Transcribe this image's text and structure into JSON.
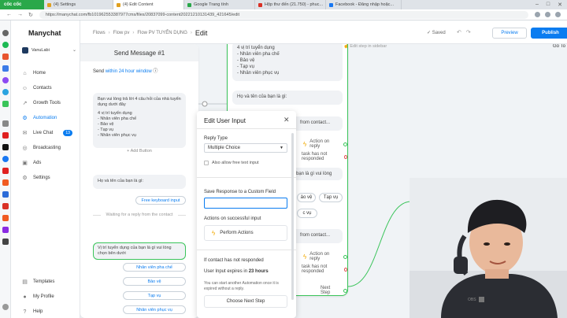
{
  "browser": {
    "brand": "cốc cốc",
    "tabs": [
      {
        "label": "(4) Settings",
        "active": false
      },
      {
        "label": "(4) Edit Content",
        "active": true
      },
      {
        "label": "Google Trang tính",
        "active": false
      },
      {
        "label": "Hộp thư đến (21.750) - phuc...",
        "active": false
      },
      {
        "label": "Facebook - Đăng nhập hoặc...",
        "active": false
      }
    ],
    "url": "https://manychat.com/fb101962553387977cms/files/20837099-content20221210131439_421645/edit"
  },
  "sidebar": {
    "logo": "Manychat",
    "account": "VanuLabi",
    "items": [
      {
        "label": "Home",
        "icon": "home-icon"
      },
      {
        "label": "Contacts",
        "icon": "contacts-icon"
      },
      {
        "label": "Growth Tools",
        "icon": "growth-icon"
      },
      {
        "label": "Automation",
        "icon": "automation-icon",
        "active": true
      },
      {
        "label": "Live Chat",
        "icon": "chat-icon",
        "badge": "13"
      },
      {
        "label": "Broadcasting",
        "icon": "broadcast-icon"
      },
      {
        "label": "Ads",
        "icon": "ads-icon"
      },
      {
        "label": "Settings",
        "icon": "settings-icon"
      }
    ],
    "bottom": [
      {
        "label": "Templates",
        "icon": "templates-icon"
      },
      {
        "label": "My Profile",
        "icon": "profile-icon"
      },
      {
        "label": "Help",
        "icon": "help-icon"
      }
    ]
  },
  "header": {
    "crumbs": [
      "Flows",
      "Flow pv",
      "Flow PV TUYỂN DỤNG"
    ],
    "current": "Edit",
    "saved": "Saved",
    "preview": "Preview",
    "publish": "Publish",
    "go_to": "Go To"
  },
  "flow_left": {
    "title": "Send Message #1",
    "send_prefix": "Send",
    "send_link": "within 24 hour window",
    "bubble_text": [
      "Bạn vui lòng trả lời 4 câu hỏi của nhà tuyển dụng dưới đây",
      "",
      "4 vị trí tuyển dụng",
      "- Nhân viên pha chế",
      "- Bảo vệ",
      "- Tạp vụ",
      "- Nhân viên phục vụ"
    ],
    "add_button": "+ Add Button",
    "question": "Họ và tên của bạn là gì:",
    "quick_reply": "Free keyboard input",
    "waiting": "Waiting for a reply from the contact",
    "question2": "Vị trí tuyển dụng của bạn là gì vui lòng chọn bên dưới",
    "options": [
      "Nhân viên pha chế",
      "Bảo vệ",
      "Tạp vụ",
      "Nhân viên phục vụ"
    ]
  },
  "flow_right": {
    "list": [
      "4 vị trí tuyển dụng",
      "- Nhân viên pha chế",
      "- Bảo vệ",
      "- Tạp vụ",
      "- Nhân viên phục vụ"
    ],
    "question": "Họ và tên của bạn là gì:",
    "from_contact": "from contact...",
    "action_on_reply": "Action on reply",
    "task_not_responded": "task has not responded",
    "partial_question": "ủ bạn là gì vui lòng",
    "partial_opts": [
      "ảo vệ",
      "Tạp vụ",
      "c vụ"
    ],
    "next_step": "Next Step",
    "hint": "Edit step in sidebar"
  },
  "modal": {
    "title": "Edit User Input",
    "reply_type_label": "Reply Type",
    "reply_type_value": "Multiple Choice",
    "allow_free_text": "Also allow free text input",
    "save_label": "Save Response to a Custom Field",
    "save_value": "",
    "actions_label": "Actions on successful input",
    "perform_actions": "Perform Actions",
    "not_responded_label": "If contact has not responded",
    "expires_prefix": "User Input expires in",
    "expires_value": "23 hours",
    "expires_note": "You can start another Automation once it is expired without a reply.",
    "next_step": "Choose Next Step"
  },
  "camera": {
    "watermark": "OBS"
  }
}
